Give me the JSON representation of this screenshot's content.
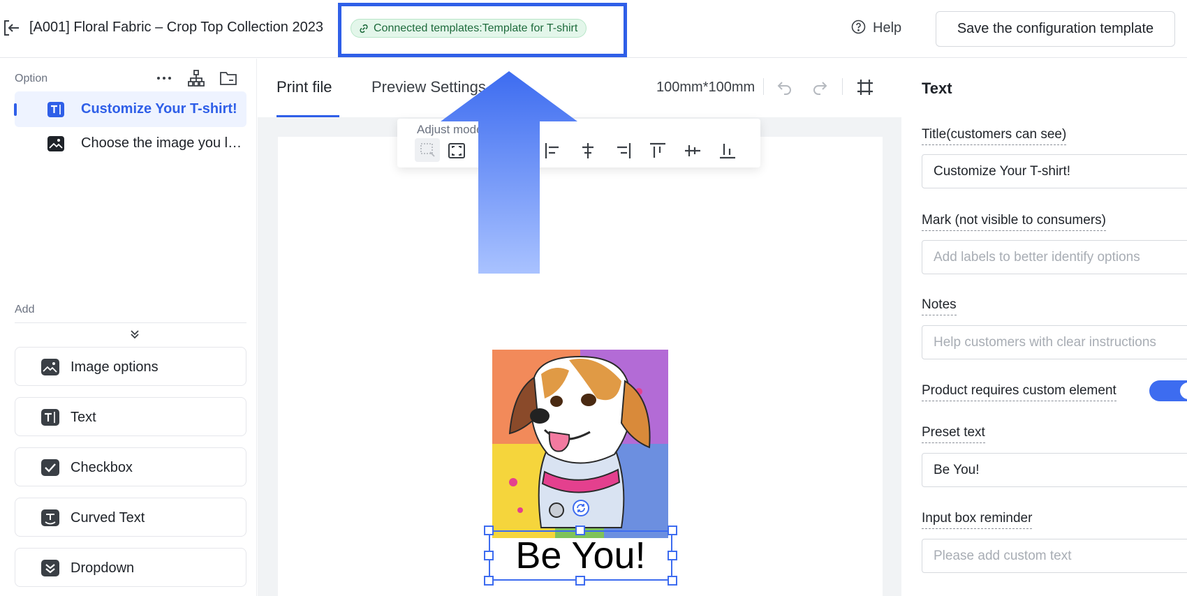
{
  "header": {
    "title": "[A001] Floral Fabric – Crop Top Collection 2023",
    "connected_template": "Connected templates:Template for T-shirt",
    "help_label": "Help",
    "save_label": "Save the configuration template"
  },
  "left_panel": {
    "option_heading": "Option",
    "options": [
      {
        "label": "Customize Your T-shirt!",
        "icon": "text-icon",
        "active": true
      },
      {
        "label": "Choose the image you like",
        "icon": "image-icon",
        "active": false
      }
    ],
    "add_heading": "Add",
    "add_items": [
      {
        "label": "Image options",
        "icon": "image-icon"
      },
      {
        "label": "Text",
        "icon": "text-icon"
      },
      {
        "label": "Checkbox",
        "icon": "checkbox-icon"
      },
      {
        "label": "Curved Text",
        "icon": "curved-text-icon"
      },
      {
        "label": "Dropdown",
        "icon": "dropdown-icon"
      }
    ]
  },
  "center": {
    "tabs": [
      "Print file",
      "Preview Settings"
    ],
    "active_tab": "Print file",
    "size_label": "100mm*100mm",
    "align_label": "Adjust mode",
    "canvas_text": "Be You!"
  },
  "right_panel": {
    "title": "Text",
    "title_label": "Title(customers can see)",
    "title_value": "Customize Your T-shirt!",
    "mark_label": "Mark (not visible to consumers)",
    "mark_placeholder": "Add labels to better identify options",
    "notes_label": "Notes",
    "notes_placeholder": "Help customers with clear instructions",
    "requires_label": "Product requires custom element",
    "requires_on": true,
    "preset_label": "Preset text",
    "preset_value": "Be You!",
    "reminder_label": "Input box reminder",
    "reminder_placeholder": "Please add custom text"
  },
  "colors": {
    "accent": "#2f5fe8",
    "badge_bg": "#e3f6ea",
    "badge_text": "#1e6b3c"
  }
}
